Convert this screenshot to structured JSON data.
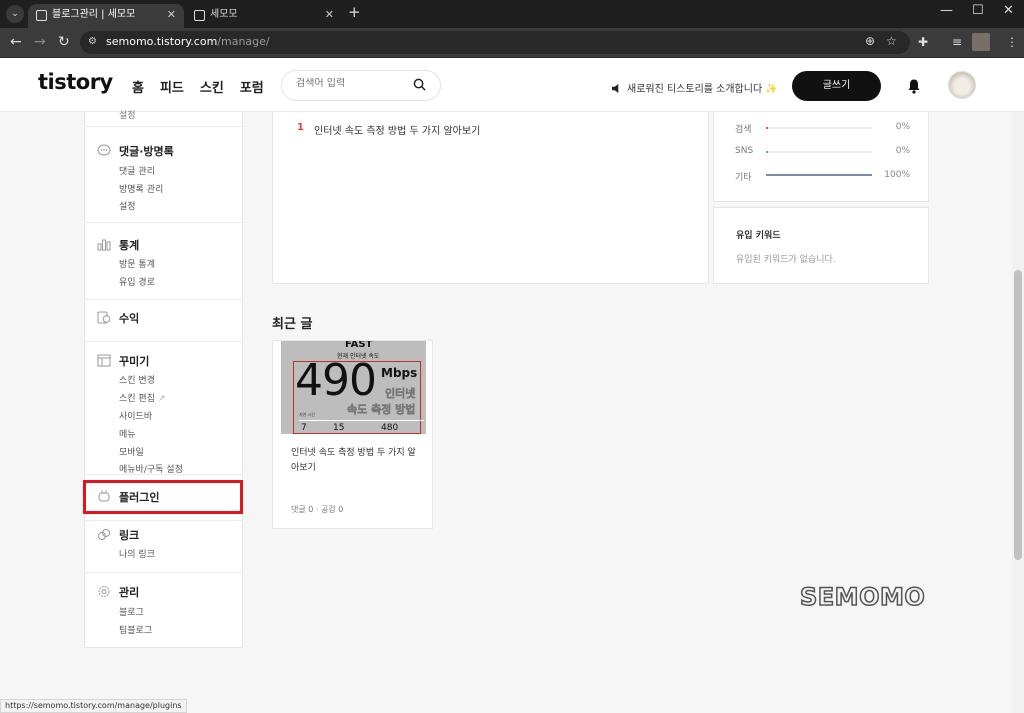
{
  "browser": {
    "tabs": [
      {
        "title": "블로그관리 | 세모모",
        "active": true
      },
      {
        "title": "세모모",
        "active": false
      }
    ],
    "new_tab": "+",
    "url_host": "semomo.tistory.com",
    "url_path": "/manage/",
    "window_controls": [
      "—",
      "☐",
      "✕"
    ],
    "status_url": "https://semomo.tistory.com/manage/plugins"
  },
  "header": {
    "logo": "tistory",
    "nav": [
      "홈",
      "피드",
      "스킨",
      "포럼"
    ],
    "search_placeholder": "검색어 입력",
    "notice": "새로워진 티스토리를 소개합니다 ✨",
    "write_button": "글쓰기"
  },
  "sidebar": {
    "cut_item": "설정",
    "groups": [
      {
        "title": "댓글·방명록",
        "icon": "comment-icon",
        "items": [
          "댓글 관리",
          "방명록 관리",
          "설정"
        ]
      },
      {
        "title": "통계",
        "icon": "chart-icon",
        "items": [
          "방문 통계",
          "유입 경로"
        ]
      },
      {
        "title": "수익",
        "icon": "coin-icon",
        "items": []
      },
      {
        "title": "꾸미기",
        "icon": "layout-icon",
        "items": [
          "스킨 변경",
          "스킨 편집",
          "사이드바",
          "메뉴",
          "모바일",
          "메뉴바/구독 설정"
        ]
      },
      {
        "title": "플러그인",
        "icon": "plug-icon",
        "items": []
      },
      {
        "title": "링크",
        "icon": "link-icon",
        "items": [
          "나의 링크"
        ]
      },
      {
        "title": "관리",
        "icon": "gear-icon",
        "items": [
          "블로그",
          "팀블로그"
        ]
      }
    ]
  },
  "popular_posts": [
    {
      "rank": "1",
      "title": "인터넷 속도 측정 방법 두 가지 알아보기"
    }
  ],
  "referrer_stats": [
    {
      "label": "검색",
      "percent": "0%",
      "fraction": 0.0
    },
    {
      "label": "SNS",
      "percent": "0%",
      "fraction": 0.0
    },
    {
      "label": "기타",
      "percent": "100%",
      "fraction": 1.0
    }
  ],
  "keywords": {
    "title": "유입 키워드",
    "empty": "유입된 키워드가 없습니다."
  },
  "recent": {
    "section_title": "최근 글",
    "posts": [
      {
        "title": "인터넷 속도 측정 방법 두 가지 알아보기",
        "meta": "댓글 0 · 공감 0",
        "thumb": {
          "brand": "FAST",
          "caption": "현재 인터넷 속도",
          "speed": "490",
          "unit": "Mbps",
          "overlay1": "인터넷",
          "overlay2": "속도 측정 방법",
          "small_label": "지연 시간",
          "nums": [
            "7",
            "15",
            "480"
          ]
        }
      }
    ]
  },
  "watermark": "SEMOMO",
  "colors": {
    "accent_red": "#e2141e",
    "rank_red": "#e0443a",
    "bar": "#7d8ab0"
  }
}
